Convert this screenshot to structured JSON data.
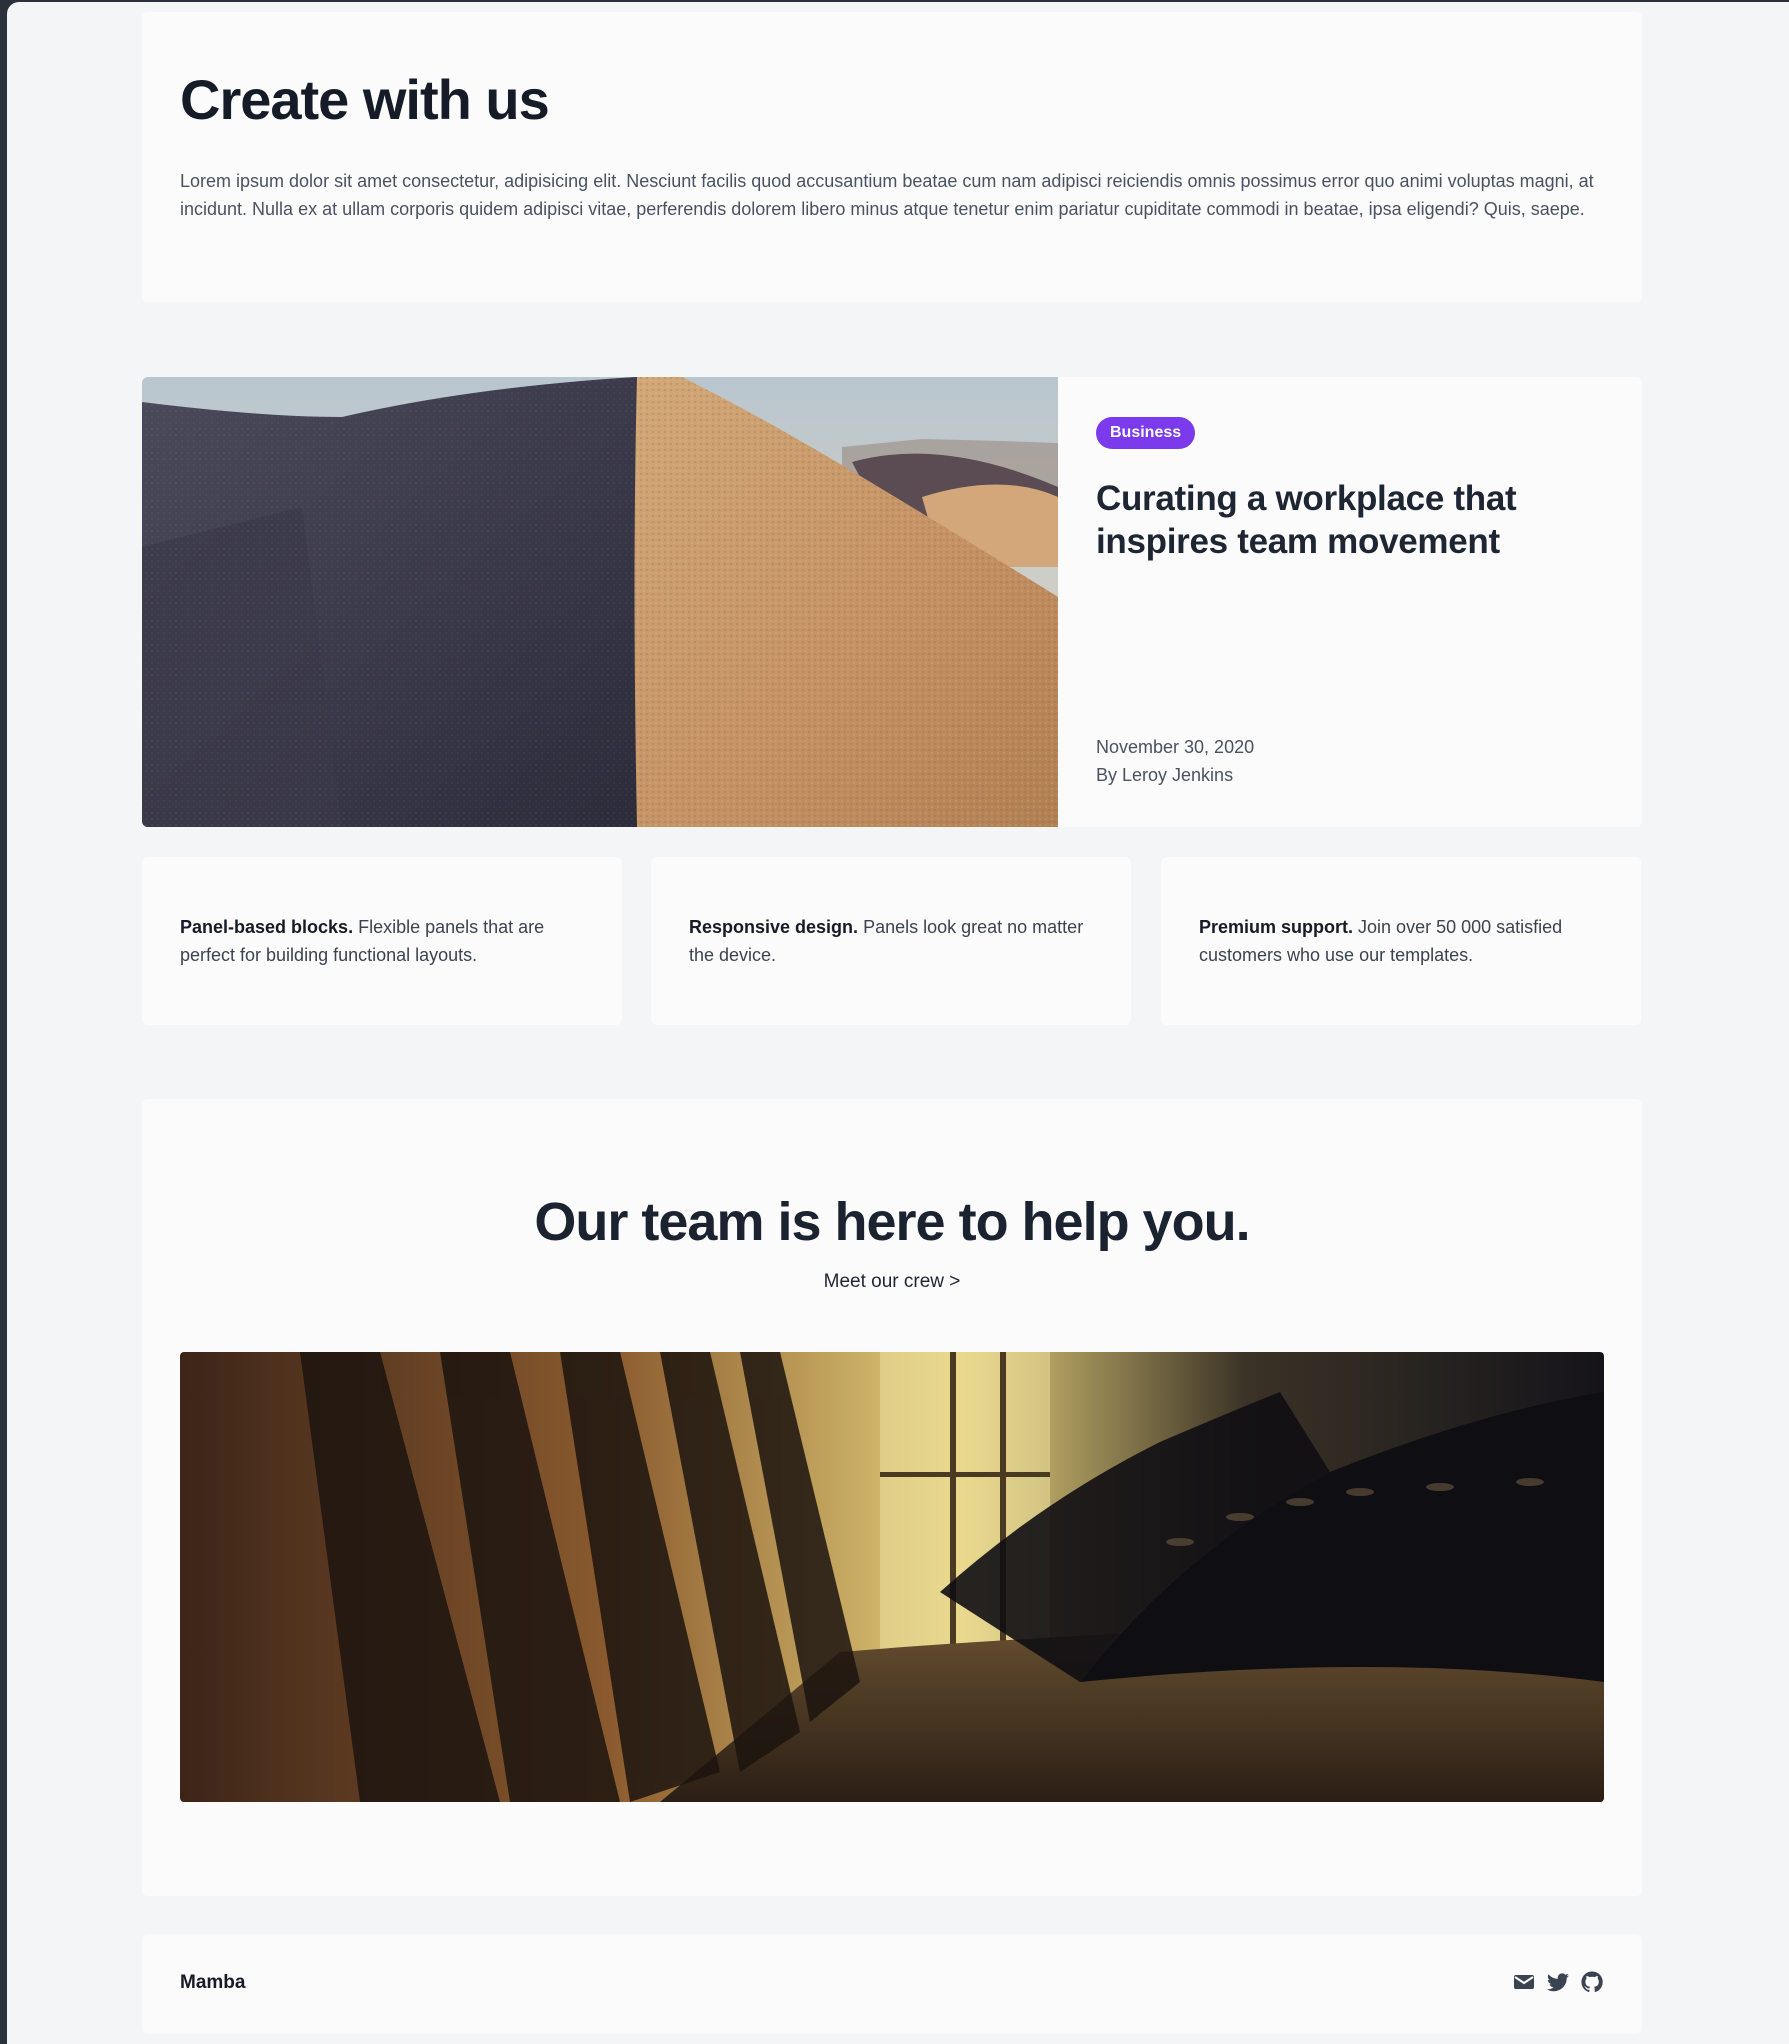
{
  "intro": {
    "title": "Create with us",
    "body": "Lorem ipsum dolor sit amet consectetur, adipisicing elit. Nesciunt facilis quod accusantium beatae cum nam adipisci reiciendis omnis possimus error quo animi voluptas magni, at incidunt. Nulla ex at ullam corporis quidem adipisci vitae, perferendis dolorem libero minus atque tenetur enim pariatur cupiditate commodi in beatae, ipsa eligendi? Quis, saepe."
  },
  "feature": {
    "badge": "Business",
    "title": "Curating a workplace that inspires team movement",
    "date": "November 30, 2020",
    "author": "By Leroy Jenkins",
    "badge_color": "#7c3aed"
  },
  "cards": [
    {
      "title": "Panel-based blocks.",
      "text": " Flexible panels that are perfect for building functional layouts."
    },
    {
      "title": "Responsive design.",
      "text": " Panels look great no matter the device."
    },
    {
      "title": "Premium support.",
      "text": " Join over 50 000 satisfied customers who use our templates."
    }
  ],
  "team": {
    "title": "Our team is here to help you.",
    "link": "Meet our crew >"
  },
  "footer": {
    "brand": "Mamba",
    "icons": [
      "mail-icon",
      "twitter-icon",
      "github-icon"
    ]
  }
}
